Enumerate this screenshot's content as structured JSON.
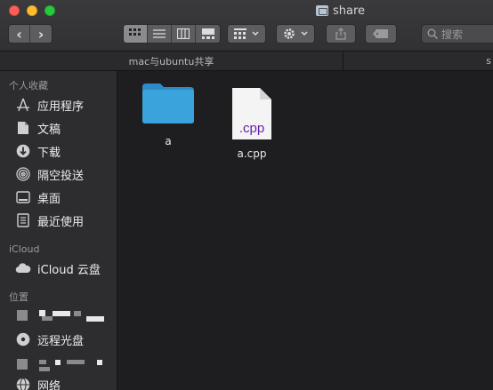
{
  "window": {
    "title": "share"
  },
  "toolbar": {
    "search_placeholder": "搜索",
    "back_glyph": "‹",
    "forward_glyph": "›"
  },
  "pathbar": {
    "current": "mac与ubuntu共享",
    "second_tab_fragment": "s"
  },
  "sidebar": {
    "favorites_header": "个人收藏",
    "favorites": [
      {
        "label": "应用程序",
        "icon": "applications-icon"
      },
      {
        "label": "文稿",
        "icon": "documents-icon"
      },
      {
        "label": "下载",
        "icon": "downloads-icon"
      },
      {
        "label": "隔空投送",
        "icon": "airdrop-icon"
      },
      {
        "label": "桌面",
        "icon": "desktop-icon"
      },
      {
        "label": "最近使用",
        "icon": "recents-icon"
      }
    ],
    "icloud_header": "iCloud",
    "icloud_item": "iCloud 云盘",
    "locations_header": "位置",
    "remote_disc": "远程光盘",
    "network": "网络"
  },
  "files": [
    {
      "name": "a",
      "kind": "folder"
    },
    {
      "name": "a.cpp",
      "kind": "document",
      "badge": ".cpp"
    }
  ],
  "colors": {
    "folder": "#3aa3dc",
    "cpp_badge": "#6a1fa5"
  }
}
